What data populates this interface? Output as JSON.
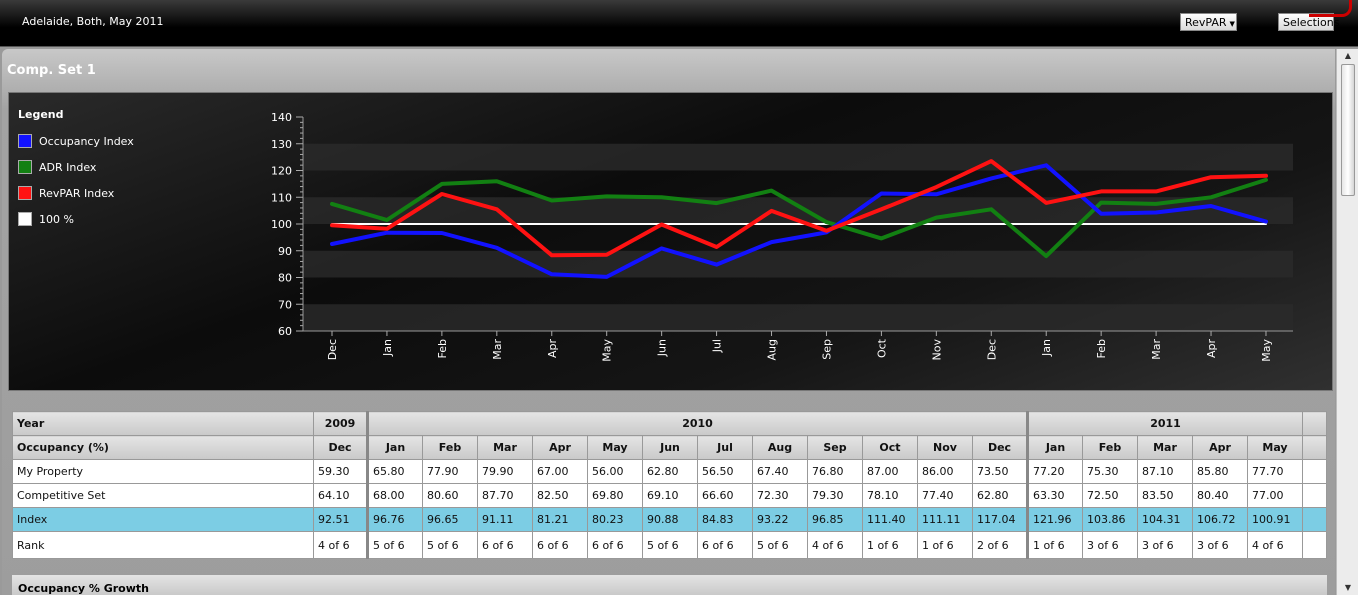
{
  "header": {
    "title": "Adelaide, Both, May 2011",
    "metric_label": "RevPAR",
    "selections_label": "Selections"
  },
  "panel": {
    "title": "Comp. Set 1"
  },
  "legend": {
    "heading": "Legend",
    "items": [
      {
        "label": "Occupancy Index",
        "color": "#1212ff"
      },
      {
        "label": "ADR Index",
        "color": "#128012"
      },
      {
        "label": "RevPAR Index",
        "color": "#ff1212"
      },
      {
        "label": "100 %",
        "color": "#ffffff"
      }
    ]
  },
  "chart_data": {
    "type": "line",
    "categories": [
      "Dec",
      "Jan",
      "Feb",
      "Mar",
      "Apr",
      "May",
      "Jun",
      "Jul",
      "Aug",
      "Sep",
      "Oct",
      "Nov",
      "Dec",
      "Jan",
      "Feb",
      "Mar",
      "Apr",
      "May"
    ],
    "ylim": [
      60,
      140
    ],
    "yticks": [
      60,
      70,
      80,
      90,
      100,
      110,
      120,
      130,
      140
    ],
    "grid": "alternating bands",
    "legend_position": "left",
    "series": [
      {
        "name": "Occupancy Index",
        "color": "#1212ff",
        "values": [
          92.51,
          96.76,
          96.65,
          91.11,
          81.21,
          80.23,
          90.88,
          84.83,
          93.22,
          96.85,
          111.4,
          111.11,
          117.04,
          121.96,
          103.86,
          104.31,
          106.72,
          100.91
        ]
      },
      {
        "name": "ADR Index",
        "color": "#128012",
        "values": [
          107.5,
          101.5,
          115,
          116,
          108.8,
          110.3,
          110,
          107.8,
          112.5,
          100.7,
          94.6,
          102.4,
          105.5,
          88,
          108,
          107.5,
          110,
          116.5
        ]
      },
      {
        "name": "RevPAR Index",
        "color": "#ff1212",
        "values": [
          99.5,
          98.2,
          111.2,
          105.5,
          88.3,
          88.5,
          99.8,
          91.4,
          104.9,
          97.5,
          105.5,
          113.8,
          123.5,
          107.9,
          112.2,
          112.2,
          117.5,
          118
        ]
      },
      {
        "name": "100 %",
        "color": "#ffffff",
        "values": [
          100,
          100,
          100,
          100,
          100,
          100,
          100,
          100,
          100,
          100,
          100,
          100,
          100,
          100,
          100,
          100,
          100,
          100
        ]
      }
    ]
  },
  "table": {
    "year_label": "Year",
    "years": [
      {
        "label": "2009",
        "span": 1
      },
      {
        "label": "2010",
        "span": 12
      },
      {
        "label": "2011",
        "span": 5
      }
    ],
    "metric_label": "Occupancy (%)",
    "months": [
      "Dec",
      "Jan",
      "Feb",
      "Mar",
      "Apr",
      "May",
      "Jun",
      "Jul",
      "Aug",
      "Sep",
      "Oct",
      "Nov",
      "Dec",
      "Jan",
      "Feb",
      "Mar",
      "Apr",
      "May"
    ],
    "rows": [
      {
        "label": "My Property",
        "values": [
          "59.30",
          "65.80",
          "77.90",
          "79.90",
          "67.00",
          "56.00",
          "62.80",
          "56.50",
          "67.40",
          "76.80",
          "87.00",
          "86.00",
          "73.50",
          "77.20",
          "75.30",
          "87.10",
          "85.80",
          "77.70"
        ]
      },
      {
        "label": "Competitive Set",
        "values": [
          "64.10",
          "68.00",
          "80.60",
          "87.70",
          "82.50",
          "69.80",
          "69.10",
          "66.60",
          "72.30",
          "79.30",
          "78.10",
          "77.40",
          "62.80",
          "63.30",
          "72.50",
          "83.50",
          "80.40",
          "77.00"
        ]
      },
      {
        "label": "Index",
        "values": [
          "92.51",
          "96.76",
          "96.65",
          "91.11",
          "81.21",
          "80.23",
          "90.88",
          "84.83",
          "93.22",
          "96.85",
          "111.40",
          "111.11",
          "117.04",
          "121.96",
          "103.86",
          "104.31",
          "106.72",
          "100.91"
        ]
      },
      {
        "label": "Rank",
        "values": [
          "4 of 6",
          "5 of 6",
          "5 of 6",
          "6 of 6",
          "6 of 6",
          "6 of 6",
          "5 of 6",
          "6 of 6",
          "5 of 6",
          "4 of 6",
          "1 of 6",
          "1 of 6",
          "2 of 6",
          "1 of 6",
          "3 of 6",
          "3 of 6",
          "3 of 6",
          "4 of 6"
        ]
      }
    ],
    "next_section_label": "Occupancy % Growth"
  }
}
